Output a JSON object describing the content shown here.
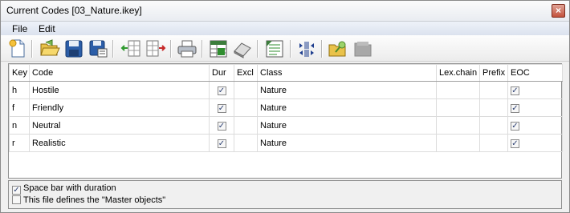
{
  "window": {
    "title": "Current Codes [03_Nature.ikey]",
    "close_glyph": "×"
  },
  "menu": {
    "file": "File",
    "edit": "Edit"
  },
  "toolbar": {
    "buttons": [
      {
        "icon": "new-document-icon"
      },
      {
        "icon": "open-folder-icon"
      },
      {
        "icon": "save-icon"
      },
      {
        "icon": "save-as-icon"
      },
      {
        "icon": "insert-row-left-icon"
      },
      {
        "icon": "insert-row-right-icon"
      },
      {
        "icon": "print-icon"
      },
      {
        "icon": "export-table-icon"
      },
      {
        "icon": "eraser-icon"
      },
      {
        "icon": "edit-sheet-icon"
      },
      {
        "icon": "columns-arrows-icon"
      },
      {
        "icon": "folder-key-icon"
      },
      {
        "icon": "disabled-folder-icon"
      }
    ]
  },
  "table": {
    "headers": {
      "key": "Key",
      "code": "Code",
      "dur": "Dur",
      "excl": "Excl",
      "class": "Class",
      "lexchain": "Lex.chain",
      "prefix": "Prefix",
      "eoc": "EOC"
    },
    "rows": [
      {
        "key": "h",
        "code": "Hostile",
        "dur": true,
        "excl": false,
        "class": "Nature",
        "lexchain": "",
        "prefix": "",
        "eoc": true
      },
      {
        "key": "f",
        "code": "Friendly",
        "dur": true,
        "excl": false,
        "class": "Nature",
        "lexchain": "",
        "prefix": "",
        "eoc": true
      },
      {
        "key": "n",
        "code": "Neutral",
        "dur": true,
        "excl": false,
        "class": "Nature",
        "lexchain": "",
        "prefix": "",
        "eoc": true
      },
      {
        "key": "r",
        "code": "Realistic",
        "dur": true,
        "excl": false,
        "class": "Nature",
        "lexchain": "",
        "prefix": "",
        "eoc": true
      }
    ]
  },
  "options": {
    "space_bar": {
      "label": "Space bar with duration",
      "checked": true
    },
    "master_objects": {
      "label": "This file defines the \"Master objects\"",
      "checked": false
    }
  },
  "check_glyph": "✓",
  "colors": {
    "close_button": "#c3513c",
    "menubar": "#dbe2ee"
  }
}
